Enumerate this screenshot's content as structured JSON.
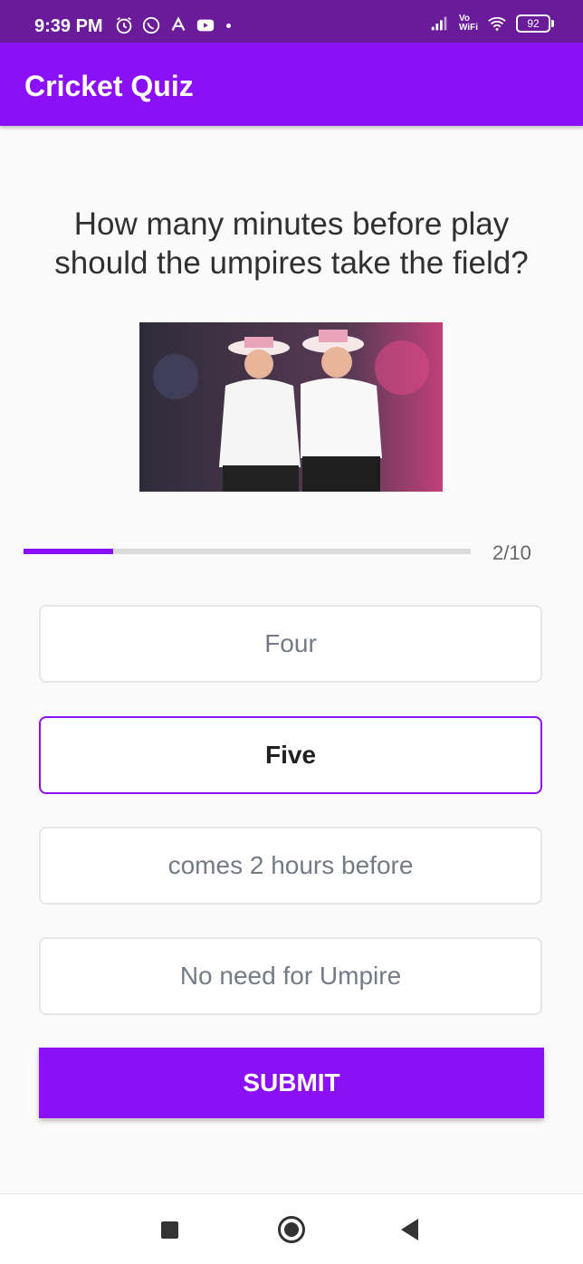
{
  "status_bar": {
    "time": "9:39 PM",
    "left_icons": [
      "alarm-icon",
      "whatsapp-icon",
      "app-icon",
      "youtube-icon"
    ],
    "vowifi_top": "Vo",
    "vowifi_bottom": "WiFi",
    "battery": "92"
  },
  "app_bar": {
    "title": "Cricket Quiz",
    "color": "#8b10f8"
  },
  "quiz": {
    "question": "How many minutes before play should the umpires take the field?",
    "progress": {
      "current": 2,
      "total": 10,
      "label": "2/10",
      "fraction": 0.2
    },
    "options": [
      {
        "label": "Four",
        "selected": false
      },
      {
        "label": "Five",
        "selected": true
      },
      {
        "label": "comes 2 hours before",
        "selected": false
      },
      {
        "label": "No need for Umpire",
        "selected": false
      }
    ],
    "submit_label": "SUBMIT"
  },
  "colors": {
    "accent": "#8b10f8",
    "status_bar": "#6a1b9a"
  }
}
